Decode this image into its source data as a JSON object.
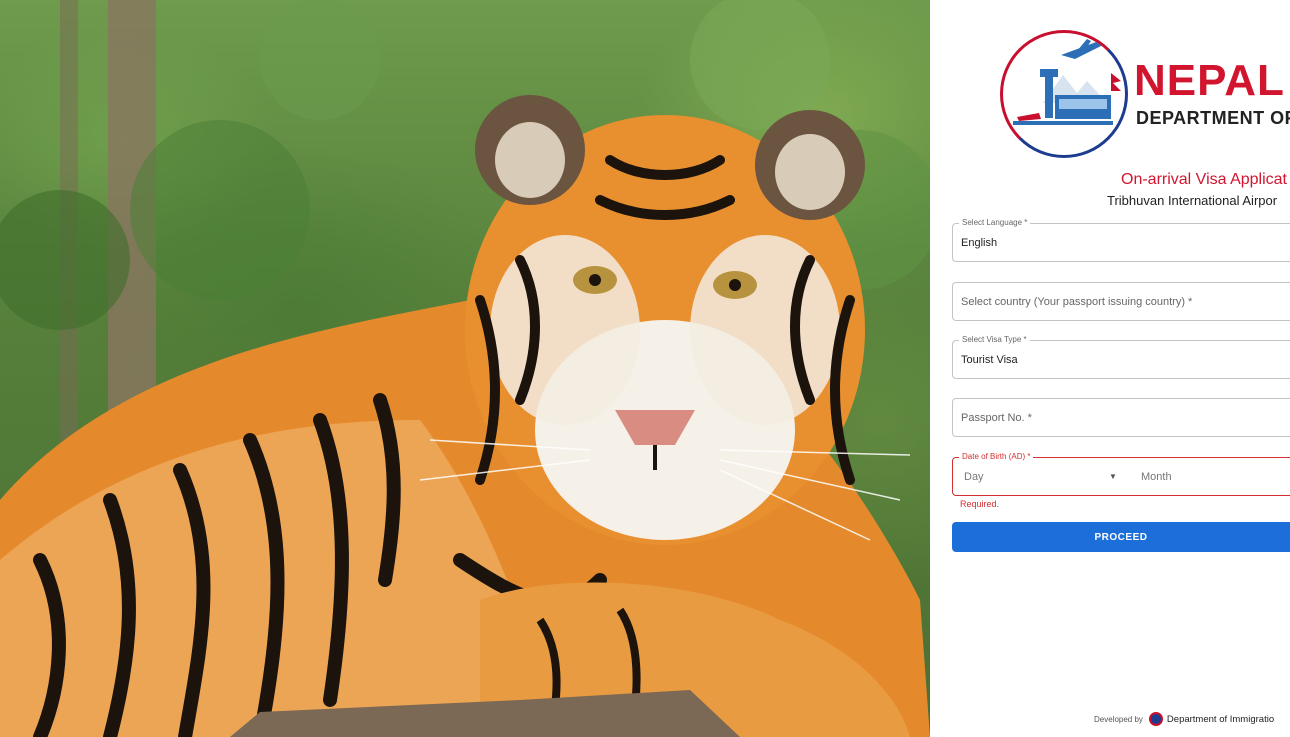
{
  "hero": {
    "image_alt": "Bengal tiger resting in a green forest"
  },
  "brand": {
    "title": "NEPAL",
    "subtitle": "DEPARTMENT OF"
  },
  "form": {
    "title": "On-arrival Visa Applicat",
    "subtitle": "Tribhuvan International Airpor",
    "language": {
      "label": "Select Language *",
      "value": "English"
    },
    "country": {
      "placeholder": "Select country (Your passport issuing country) *"
    },
    "visa_type": {
      "label": "Select Visa Type *",
      "value": "Tourist Visa"
    },
    "passport": {
      "placeholder": "Passport No. *"
    },
    "dob": {
      "label": "Date of Birth (AD) *",
      "day_placeholder": "Day",
      "month_placeholder": "Month",
      "error": "Required."
    },
    "proceed_label": "PROCEED"
  },
  "footer": {
    "developed_by": "Developed by",
    "department": "Department of Immigratio"
  },
  "colors": {
    "brand_red": "#d2152f",
    "primary_blue": "#1c6ed8",
    "error_red": "#d32f2f"
  }
}
